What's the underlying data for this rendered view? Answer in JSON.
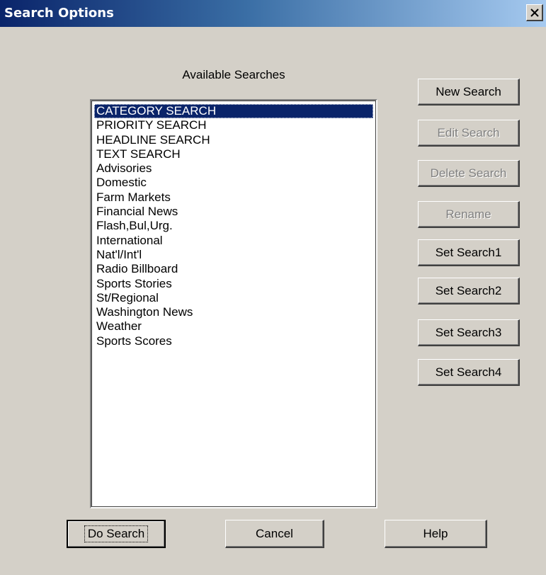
{
  "window": {
    "title": "Search Options"
  },
  "icons": {
    "close": "close-icon"
  },
  "colors": {
    "titlebar_start": "#0a246a",
    "titlebar_end": "#a6caf0",
    "face": "#d4d0c8",
    "selection": "#0a246a"
  },
  "list": {
    "label": "Available Searches",
    "selected_index": 0,
    "items": [
      "CATEGORY SEARCH",
      "PRIORITY SEARCH",
      "HEADLINE SEARCH",
      "TEXT SEARCH",
      "Advisories",
      "Domestic",
      "Farm Markets",
      "Financial News",
      "Flash,Bul,Urg.",
      "International",
      "Nat'l/Int'l",
      "Radio Billboard",
      "Sports Stories",
      "St/Regional",
      "Washington News",
      "Weather",
      "Sports Scores"
    ]
  },
  "side_buttons": {
    "new_search": "New Search",
    "edit_search": "Edit Search",
    "delete_search": "Delete Search",
    "rename": "Rename",
    "set_search1": "Set Search1",
    "set_search2": "Set Search2",
    "set_search3": "Set Search3",
    "set_search4": "Set Search4"
  },
  "bottom_buttons": {
    "do_search": "Do Search",
    "cancel": "Cancel",
    "help": "Help"
  }
}
